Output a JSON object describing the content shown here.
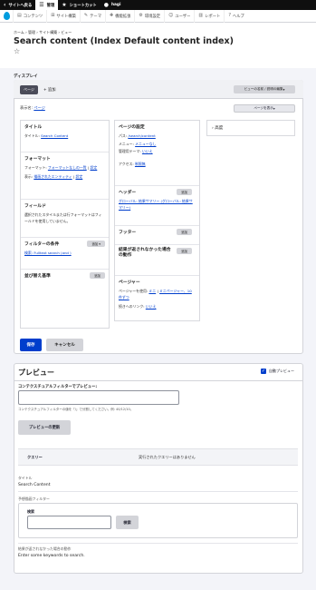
{
  "toolbar": {
    "back": "サイトへ戻る",
    "manage": "管理",
    "shortcuts": "ショートカット",
    "user": "hagi"
  },
  "tray": {
    "items": [
      "コンテンツ",
      "サイト構築",
      "テーマ",
      "機能拡張",
      "環境設定",
      "ユーザー",
      "レポート",
      "ヘルプ"
    ]
  },
  "breadcrumb": "ホーム › 管理 › サイト構築 › ビュー",
  "page_title": "Search content (Index Default content index)",
  "display_section_label": "ディスプレイ",
  "tabs": {
    "page_tab": "ページ",
    "add": "+ 追加",
    "edit_name_button": "ビューの名前 / 説明の編集"
  },
  "display_name": {
    "label": "表示名:",
    "value": "ページ",
    "view_page_button": "ページを表示"
  },
  "col1": {
    "title_heading": "タイトル",
    "title_label": "タイトル:",
    "title_value": "Search Content",
    "format_heading": "フォーマット",
    "format_label": "フォーマット:",
    "format_value": "フォーマットなしの一覧",
    "format_settings": "設定",
    "show_label": "表示:",
    "show_value": "描画されたエンティティ",
    "show_settings": "設定",
    "fields_heading": "フィールド",
    "fields_text": "選択されたスタイルまたは行フォーマットはフィールドを使用していません。",
    "filter_heading": "フィルターの条件",
    "filter_add": "追加",
    "filter_item": "検索: Fulltext search (and )",
    "sort_heading": "並び替え基準",
    "sort_add": "追加"
  },
  "col2": {
    "page_settings_heading": "ページの設定",
    "path_label": "パス:",
    "path_value": "/search/content",
    "menu_label": "メニュー:",
    "menu_value": "メニューなし",
    "admin_theme_label": "管理用テーマ:",
    "admin_theme_value": "いいえ",
    "access_label": "アクセス:",
    "access_value": "制限無",
    "header_heading": "ヘッダー",
    "header_add": "追加",
    "header_item": "グローバル: 結果サマリー (グローバル: 結果サマリー)",
    "footer_heading": "フッター",
    "footer_add": "追加",
    "empty_heading": "結果が返されなかった場合の動作",
    "empty_add": "追加",
    "pager_heading": "ページャー",
    "pager_label": "ページャーを使用:",
    "pager_value": "ミニ",
    "pager_sep": " | ",
    "pager_items": "ミニページャー、10 件ずつ",
    "more_label": "続きへのリンク:",
    "more_value": "いいえ"
  },
  "col3": {
    "advanced": "高度"
  },
  "actions": {
    "save": "保存",
    "cancel": "キャンセル"
  },
  "preview": {
    "title": "プレビュー",
    "auto_preview": "自動プレビュー",
    "contextual_label": "コンテクスチュアルフィルターでプレビュー:",
    "contextual_help": "コンテクスチュアルフィルターの値を「/」で分割してください。例: 40/12/10。",
    "update_button": "プレビューの更新",
    "query_label": "クエリー",
    "query_value": "実行されたクエリーはありません",
    "out_title_label": "タイトル",
    "out_title_value": "Search Content",
    "exposed_label": "予想描画フィルター",
    "search_label": "検索",
    "search_button": "検索",
    "empty_label": "結果が返されなかった場合の動作",
    "empty_value": "Enter some keywords to search."
  },
  "colors": {
    "primary": "#003ecc",
    "toolbar": "#0f0f0f",
    "logo": "#009cde"
  }
}
